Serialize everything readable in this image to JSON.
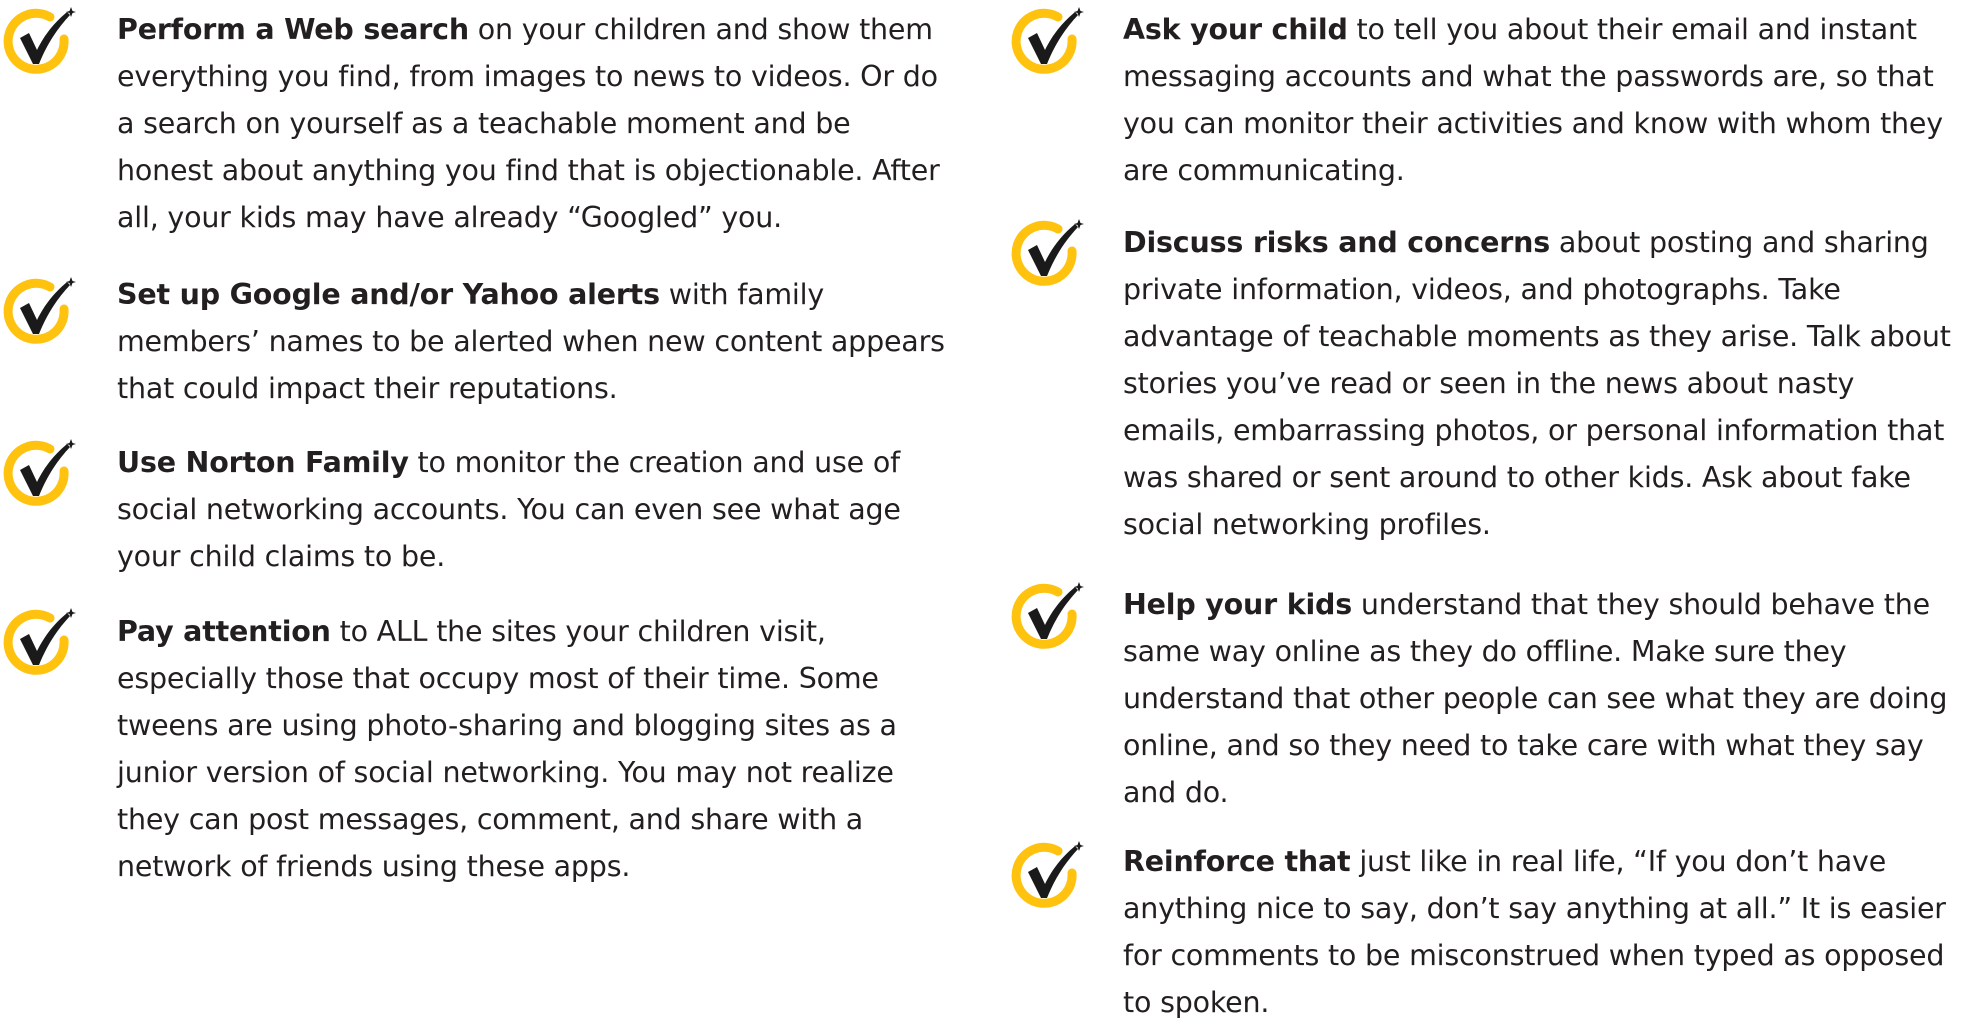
{
  "brand": {
    "check_ring_color": "#FFC20E",
    "check_mark_color": "#1A1A1A",
    "text_color": "#231F20",
    "icon": "norton-checkmark-icon"
  },
  "left_tips": [
    {
      "lead": "Perform a Web search",
      "body": " on your children and show them everything you find, from images to news to videos. Or do a search on yourself as a teachable moment and be honest about anything you find that is objectionable. After all, your kids may have already “Googled” you."
    },
    {
      "lead": "Set up Google and/or Yahoo alerts",
      "body": " with family members’ names to be alerted when new content appears that could impact their reputations."
    },
    {
      "lead": "Use Norton Family",
      "body": " to monitor the creation and use of social networking accounts. You can even see what age your child claims to be."
    },
    {
      "lead": "Pay attention",
      "body": " to ALL the sites your children visit, especially those that occupy most of their time. Some tweens are using photo-sharing and blogging sites as a junior version of social networking. You may not realize they can post messages, comment, and share with a network of friends using these apps."
    }
  ],
  "right_tips": [
    {
      "lead": "Ask your child",
      "body": " to tell you about their email and instant messaging accounts and what the passwords are, so that you can monitor their activities and know with whom they are communicating."
    },
    {
      "lead": "Discuss risks and concerns",
      "body": " about posting and sharing private information, videos, and photographs. Take advantage of teachable moments as they arise. Talk about stories you’ve read or seen in the news about nasty emails, embarrassing photos, or personal information that was shared or sent around to other kids. Ask about fake social networking profiles."
    },
    {
      "lead": "Help your kids",
      "body": " understand that they should behave the same way online as they do offline. Make sure they understand that other people can see what they are doing online, and so they need to take care with what they say and do."
    },
    {
      "lead": "Reinforce that",
      "body": " just like in real life, “If you don’t have anything nice to say, don’t say anything at all.” It is easier for comments to be misconstrued when typed as opposed to spoken."
    }
  ]
}
